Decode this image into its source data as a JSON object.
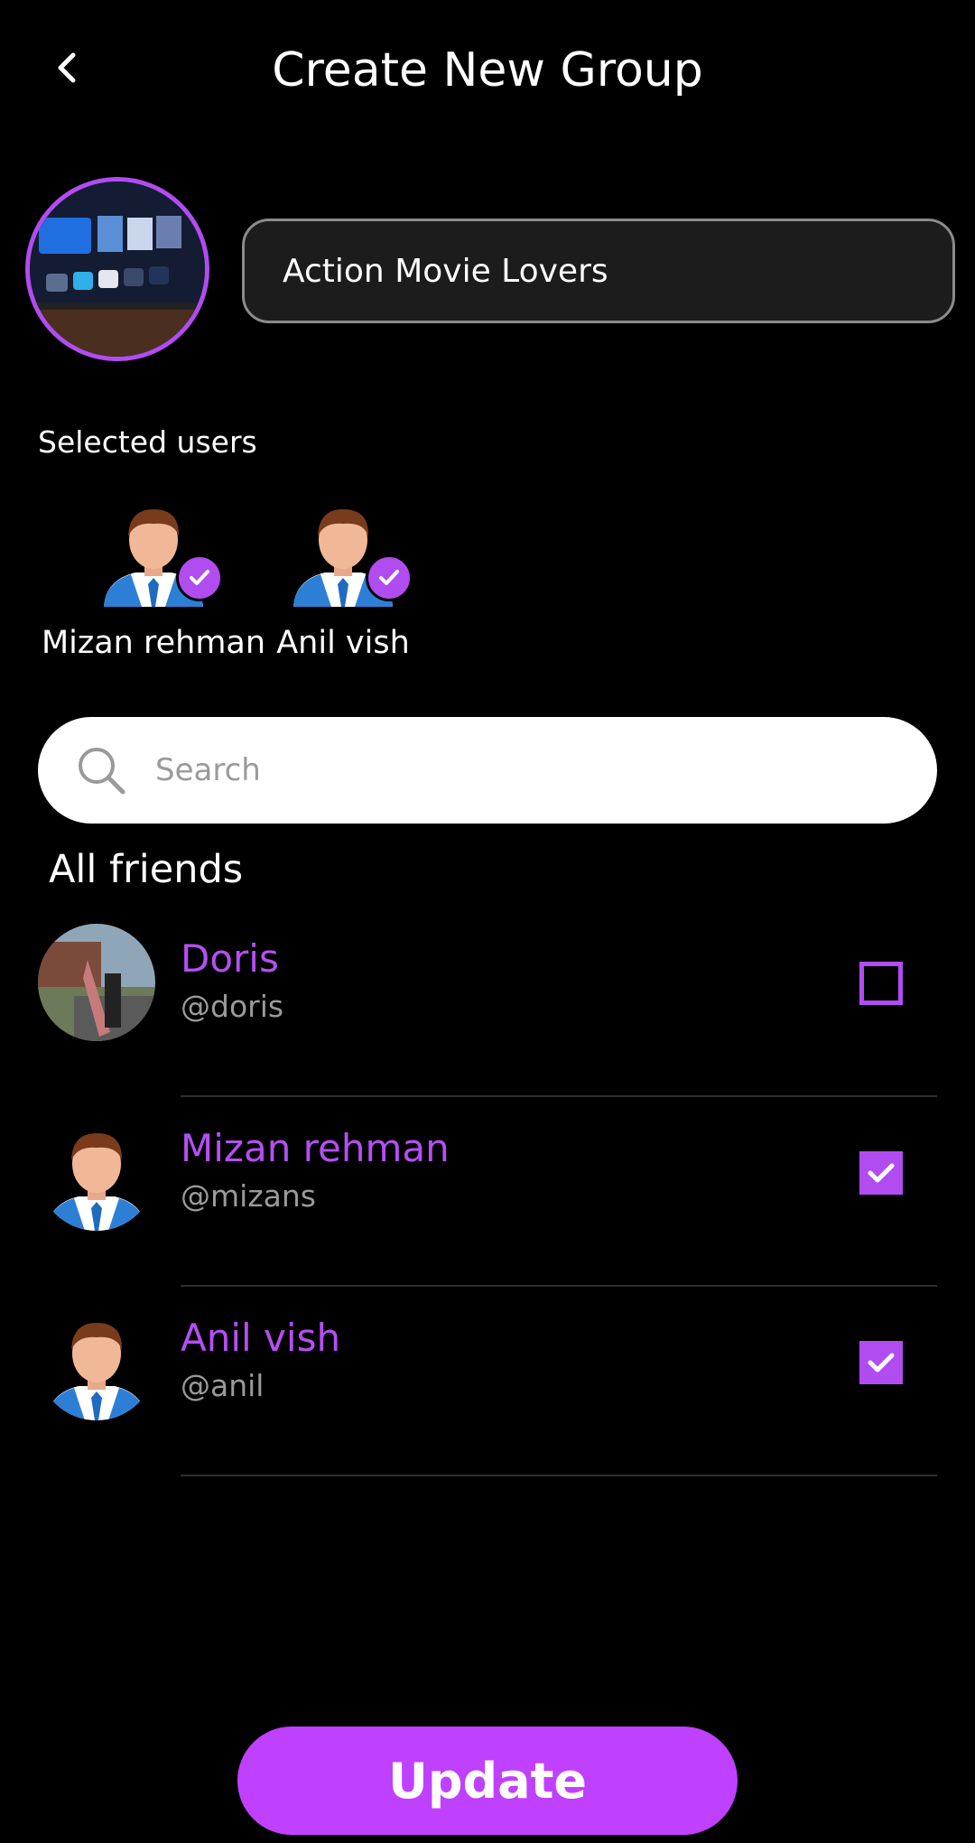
{
  "header": {
    "title": "Create New Group",
    "back_icon": "chevron-left-icon"
  },
  "group": {
    "name_value": "Action Movie Lovers",
    "photo_icon": "group-photo"
  },
  "selected": {
    "label": "Selected users",
    "users": [
      {
        "name": "Mizan rehman"
      },
      {
        "name": "Anil vish"
      }
    ]
  },
  "search": {
    "placeholder": "Search",
    "icon": "search-icon"
  },
  "friends": {
    "label": "All friends",
    "items": [
      {
        "name": "Doris",
        "handle": "@doris",
        "checked": false
      },
      {
        "name": "Mizan rehman",
        "handle": "@mizans",
        "checked": true
      },
      {
        "name": "Anil vish",
        "handle": "@anil",
        "checked": true
      }
    ]
  },
  "footer": {
    "update_label": "Update"
  },
  "colors": {
    "accent": "#b14cf0",
    "button": "#bf40ff",
    "background": "#000000"
  }
}
